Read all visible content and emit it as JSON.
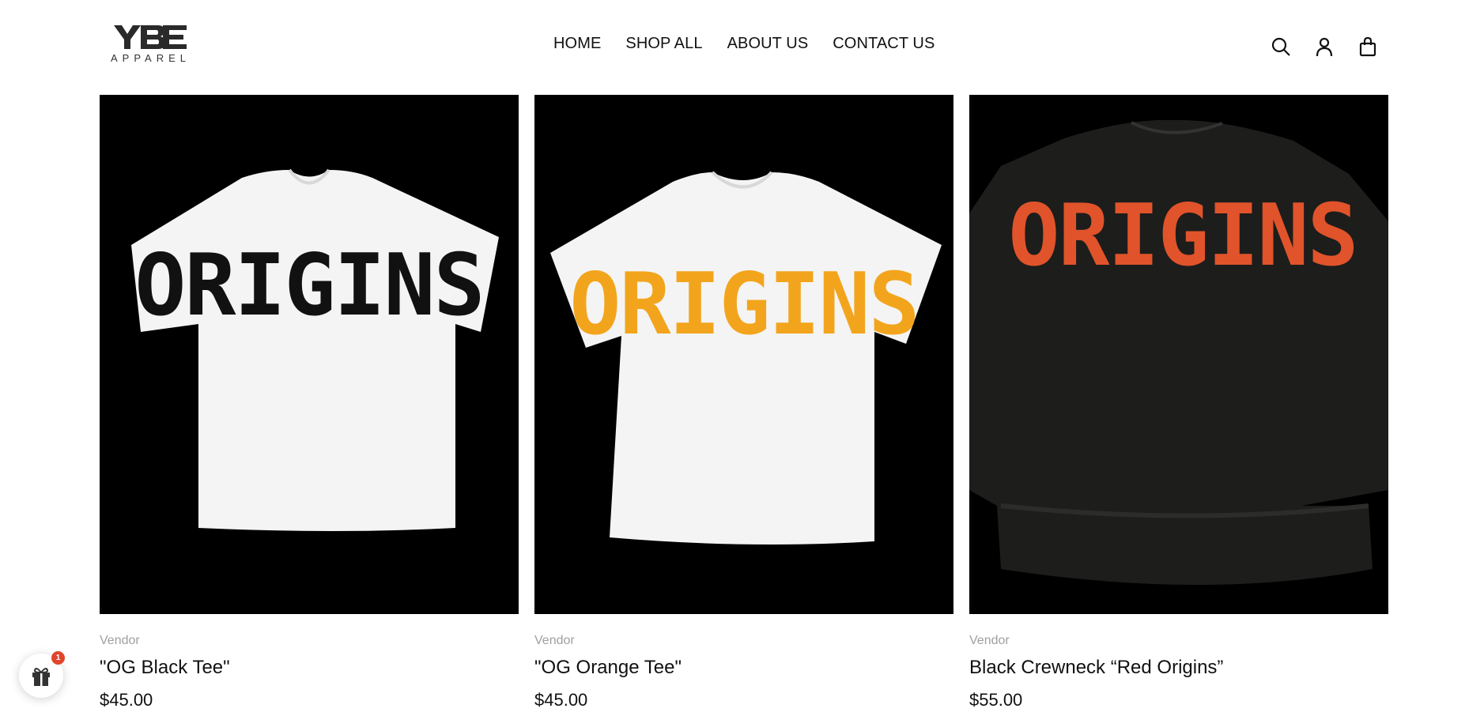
{
  "brand": {
    "logo_mark": "YBE",
    "logo_sub": "APPAREL"
  },
  "nav": {
    "items": [
      {
        "label": "HOME"
      },
      {
        "label": "SHOP ALL"
      },
      {
        "label": "ABOUT US"
      },
      {
        "label": "CONTACT US"
      }
    ]
  },
  "header_icons": [
    "search-icon",
    "account-icon",
    "cart-icon"
  ],
  "products": [
    {
      "vendor": "Vendor",
      "title": "\"OG Black Tee\"",
      "price": "$45.00",
      "graphic_text": "ORIGINS",
      "garment": "white-tee",
      "print_color": "#111111"
    },
    {
      "vendor": "Vendor",
      "title": "\"OG Orange Tee\"",
      "price": "$45.00",
      "graphic_text": "ORIGINS",
      "garment": "white-tee",
      "print_color": "#f2a51c"
    },
    {
      "vendor": "Vendor",
      "title": "Black Crewneck “Red Origins”",
      "price": "$55.00",
      "graphic_text": "ORIGINS",
      "garment": "black-crewneck",
      "print_color": "#e0532b"
    }
  ],
  "gift_widget": {
    "badge_count": "1",
    "badge_color": "#e0452b"
  }
}
